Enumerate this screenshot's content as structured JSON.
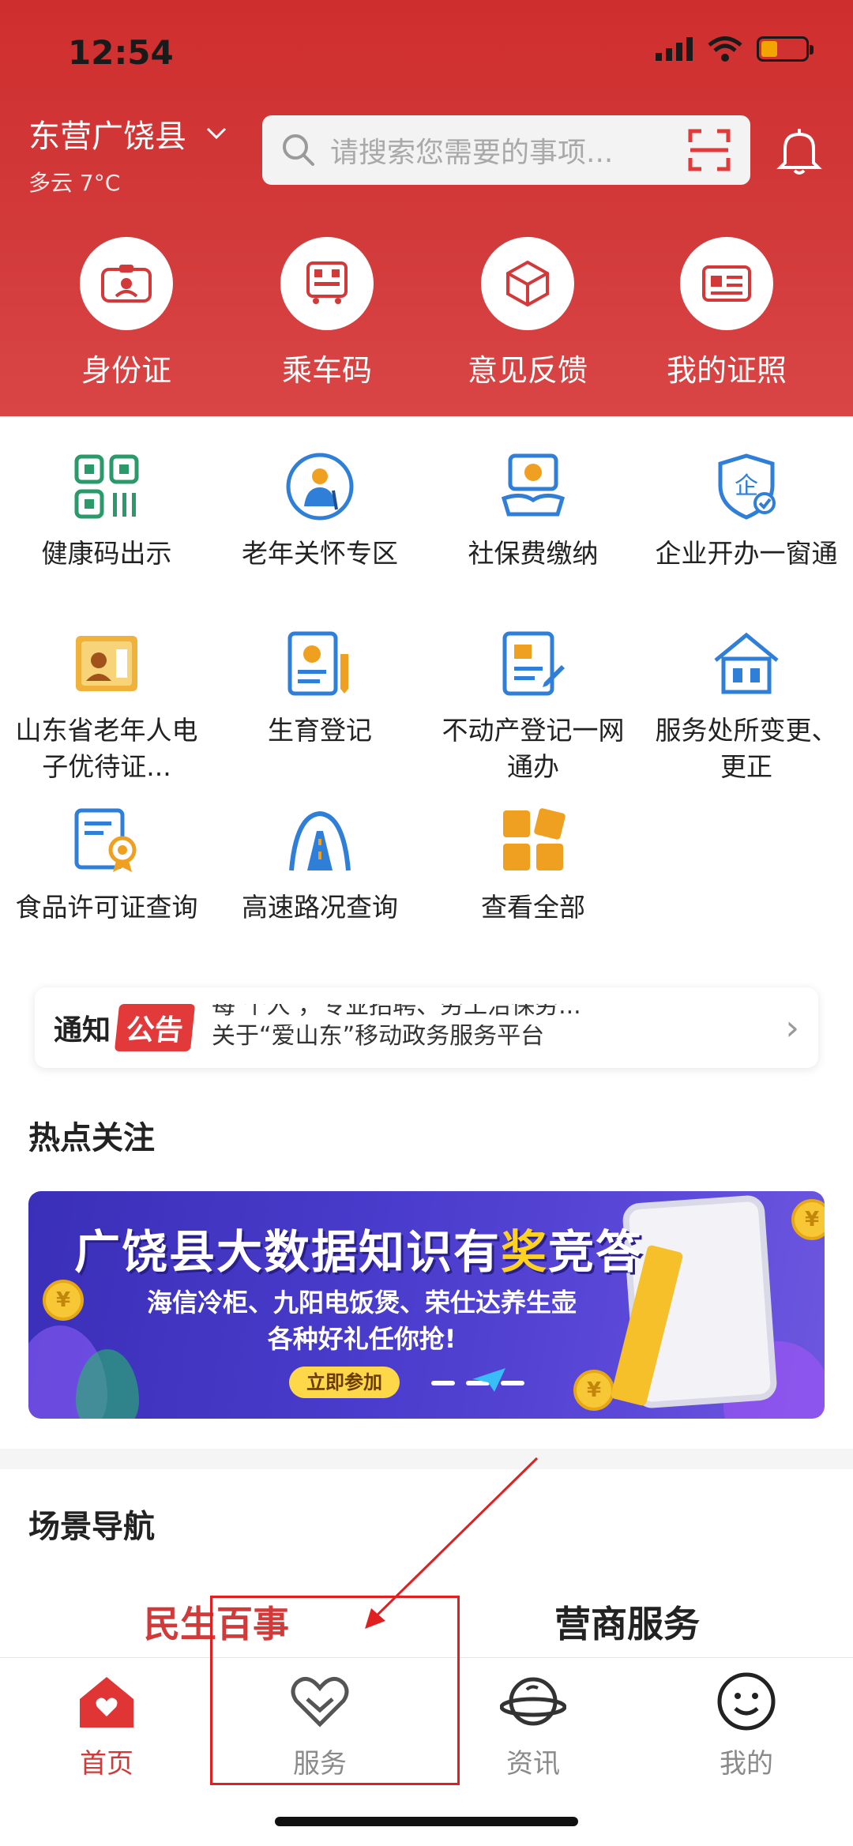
{
  "status": {
    "time": "12:54"
  },
  "location": {
    "name": "东营广饶县",
    "weather": "多云 7°C"
  },
  "search": {
    "placeholder": "请搜索您需要的事项..."
  },
  "quick_actions": [
    {
      "label": "身份证",
      "icon": "id-card-icon"
    },
    {
      "label": "乘车码",
      "icon": "bus-code-icon"
    },
    {
      "label": "意见反馈",
      "icon": "feedback-icon"
    },
    {
      "label": "我的证照",
      "icon": "license-icon"
    }
  ],
  "services": [
    {
      "label": "健康码出示",
      "icon": "qr-code-icon"
    },
    {
      "label": "老年关怀专区",
      "icon": "elderly-care-icon"
    },
    {
      "label": "社保费缴纳",
      "icon": "social-security-icon"
    },
    {
      "label": "企业开办一窗通",
      "icon": "enterprise-shield-icon"
    },
    {
      "label": "山东省老年人电子优待证...",
      "icon": "elderly-card-icon"
    },
    {
      "label": "生育登记",
      "icon": "birth-registration-icon"
    },
    {
      "label": "不动产登记一网通办",
      "icon": "property-registration-icon"
    },
    {
      "label": "服务处所变更、更正",
      "icon": "house-change-icon"
    },
    {
      "label": "食品许可证查询",
      "icon": "food-license-icon"
    },
    {
      "label": "高速路况查询",
      "icon": "highway-icon"
    },
    {
      "label": "查看全部",
      "icon": "view-all-icon"
    }
  ],
  "notice": {
    "tag_left": "通知",
    "tag_right": "公告",
    "line1": "每 个人 ，专业招聘、劳工治保劳...",
    "line2": "关于“爱山东”移动政务服务平台"
  },
  "hot": {
    "title": "热点关注",
    "banner_title_a": "广饶县大数据知识有",
    "banner_title_hl": "奖",
    "banner_title_b": "竞答",
    "banner_sub1": "海信冷柜、九阳电饭煲、荣仕达养生壶",
    "banner_sub2": "各种好礼任你抢!",
    "banner_button": "立即参加",
    "coin_symbol": "¥"
  },
  "scene": {
    "title": "场景导航",
    "tabs": [
      "民生百事",
      "营商服务"
    ]
  },
  "nav": [
    {
      "label": "首页",
      "icon": "home-icon",
      "active": true
    },
    {
      "label": "服务",
      "icon": "heart-service-icon",
      "active": false
    },
    {
      "label": "资讯",
      "icon": "planet-news-icon",
      "active": false
    },
    {
      "label": "我的",
      "icon": "smiley-profile-icon",
      "active": false
    }
  ],
  "colors": {
    "brand_red": "#d23a3a",
    "accent_blue": "#2f7fd8",
    "accent_orange": "#f0a020",
    "inactive_gray": "#8a8a8a"
  }
}
